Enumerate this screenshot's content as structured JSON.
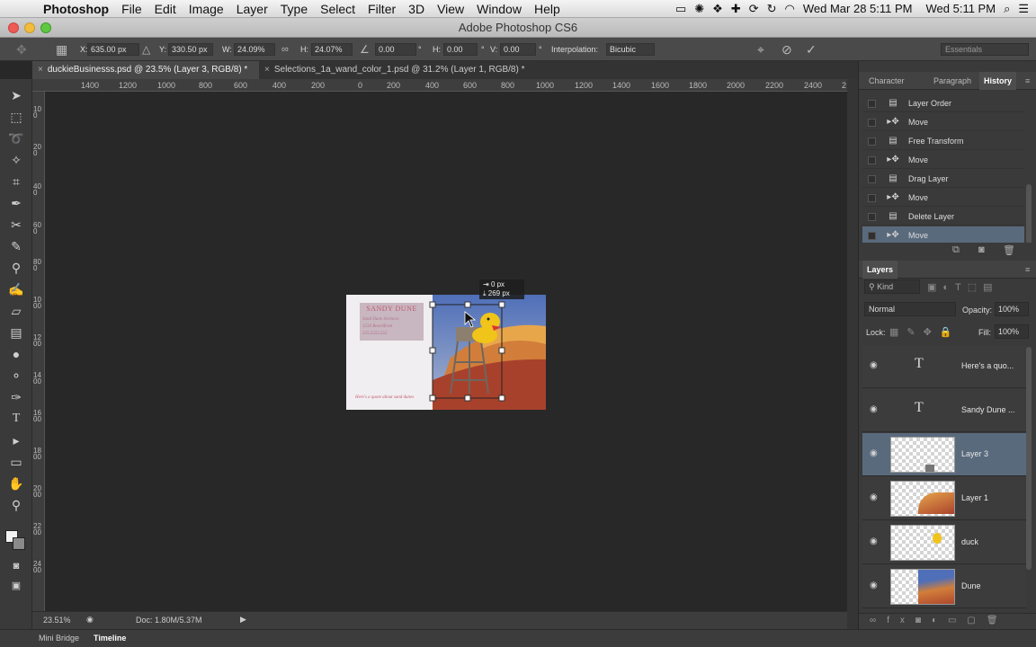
{
  "menubar": {
    "apple_glyph": "",
    "app": "Photoshop",
    "items": [
      "File",
      "Edit",
      "Image",
      "Layer",
      "Type",
      "Select",
      "Filter",
      "3D",
      "View",
      "Window",
      "Help"
    ],
    "clock1": "Wed Mar 28  5:11 PM",
    "clock2": "Wed 5:11 PM"
  },
  "window": {
    "title": "Adobe Photoshop CS6"
  },
  "options": {
    "x_label": "X:",
    "x_value": "635.00 px",
    "y_label": "Y:",
    "y_value": "330.50 px",
    "w_label": "W:",
    "w_value": "24.09%",
    "h_label": "H:",
    "h_value": "24.07%",
    "rot_value": "0.00",
    "deg": "°",
    "hskew_label": "H:",
    "hskew_value": "0.00",
    "vskew_label": "V:",
    "vskew_value": "0.00",
    "interp_label": "Interpolation:",
    "interp_value": "Bicubic",
    "workspace": "Essentials"
  },
  "tabs": [
    {
      "label": "duckieBusinesss.psd @ 23.5% (Layer 3, RGB/8) *",
      "active": true
    },
    {
      "label": "Selections_1a_wand_color_1.psd @ 31.2% (Layer 1, RGB/8) *",
      "active": false
    }
  ],
  "ruler_h": [
    "1400",
    "1200",
    "1000",
    "800",
    "600",
    "400",
    "200",
    "0",
    "200",
    "400",
    "600",
    "800",
    "1000",
    "1200",
    "1400",
    "1600",
    "1800",
    "2000",
    "2200",
    "2400",
    "2"
  ],
  "ruler_v": [
    "100",
    "200",
    "400",
    "600",
    "800",
    "1000",
    "1200",
    "1400",
    "1600",
    "1800",
    "2000",
    "2200",
    "2400"
  ],
  "card": {
    "name": "SANDY DUNE",
    "addr_lines": [
      "Sand Dune Sciences",
      "1234 Beachfront",
      "555.5555.555"
    ],
    "quote": "Here's a quote about sand dunes"
  },
  "readout": {
    "x_line": "0 px",
    "y_line": "269 px"
  },
  "status": {
    "zoom": "23.51%",
    "doc": "Doc: 1.80M/5.37M"
  },
  "bottom_tabs": [
    "Mini Bridge",
    "Timeline"
  ],
  "panel_top": {
    "tabs": [
      "Character",
      "Paragraph",
      "History"
    ],
    "history": [
      "Layer Order",
      "Move",
      "Free Transform",
      "Move",
      "Drag Layer",
      "Move",
      "Delete Layer",
      "Move"
    ],
    "history_icons": [
      "doc-icon",
      "move-icon",
      "doc-icon",
      "move-icon",
      "doc-icon",
      "move-icon",
      "doc-icon",
      "move-icon"
    ]
  },
  "layers_panel": {
    "tab": "Layers",
    "filter": "Kind",
    "blend_mode": "Normal",
    "opacity_label": "Opacity:",
    "opacity": "100%",
    "lock_label": "Lock:",
    "fill_label": "Fill:",
    "fill": "100%",
    "layers": [
      {
        "name": "Here's a quo...",
        "type": "text"
      },
      {
        "name": "Sandy Dune ...",
        "type": "text"
      },
      {
        "name": "Layer 3",
        "type": "image"
      },
      {
        "name": "Layer 1",
        "type": "image"
      },
      {
        "name": "duck",
        "type": "image"
      },
      {
        "name": "Dune",
        "type": "image"
      }
    ]
  },
  "colors": {
    "accent_selection": "#5a6a7d",
    "card_name": "#c45a73"
  }
}
